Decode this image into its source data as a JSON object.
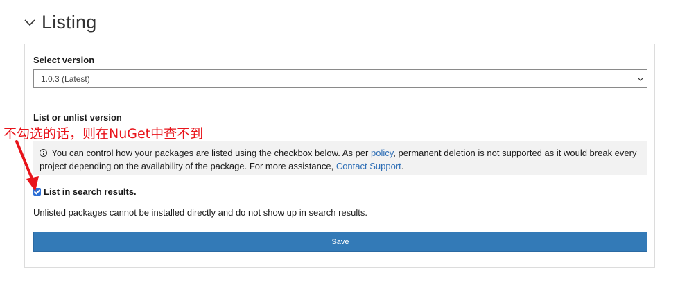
{
  "section": {
    "title": "Listing",
    "icon": "chevron-down-icon"
  },
  "version": {
    "label": "Select version",
    "selected": "1.0.3 (Latest)",
    "icon": "chevron-down-icon"
  },
  "listing": {
    "label": "List or unlist version",
    "info": {
      "icon": "info-icon",
      "text_before": "You can control how your packages are listed using the checkbox below. As per ",
      "policy_link": "policy",
      "text_middle": ", permanent deletion is not supported as it would break every project depending on the availability of the package. For more assistance, ",
      "support_link": "Contact Support",
      "text_after": "."
    },
    "checkbox_label": "List in search results.",
    "checked": true,
    "help_text": "Unlisted packages cannot be installed directly and do not show up in search results."
  },
  "save_label": "Save",
  "annotation": {
    "text": "不勾选的话，则在NuGet中查不到",
    "color": "#e8141b"
  },
  "colors": {
    "accent": "#337ab7",
    "link": "#2f6fb6",
    "checkbox": "#2a6ed6"
  }
}
